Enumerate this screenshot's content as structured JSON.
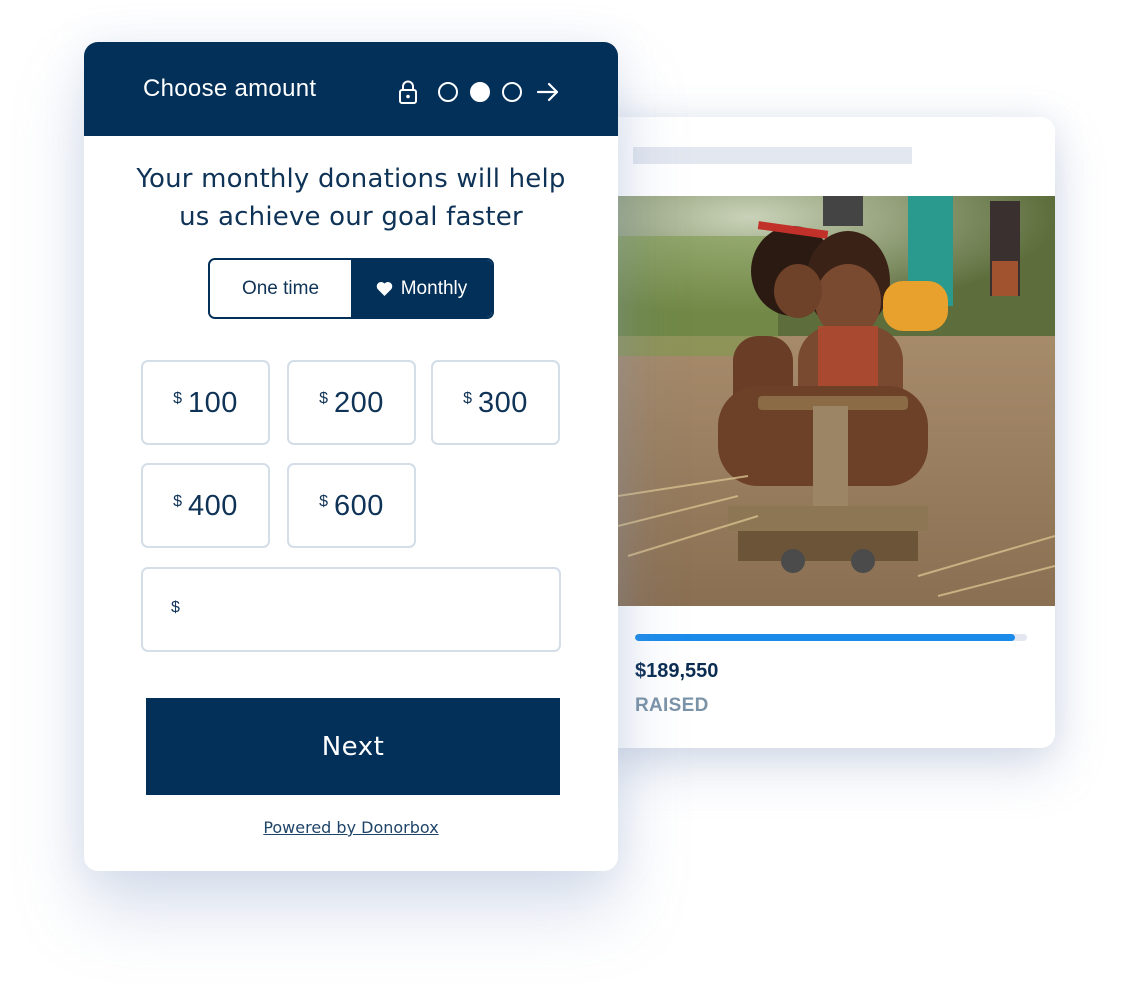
{
  "form": {
    "header": {
      "title": "Choose amount",
      "icons": [
        "lock-icon",
        "step-dot-icon",
        "step-dot-active-icon",
        "step-dot-icon",
        "arrow-right-icon"
      ],
      "steps_total": 3,
      "current_step": 2
    },
    "intro_line1": "Your monthly donations will help",
    "intro_line2": "us achieve our goal faster",
    "frequency": {
      "options": [
        {
          "label": "One time",
          "selected": false
        },
        {
          "label": "Monthly",
          "selected": true,
          "icon": "heart-icon"
        }
      ]
    },
    "currency_symbol": "$",
    "amounts": [
      {
        "value": "100"
      },
      {
        "value": "200"
      },
      {
        "value": "300"
      },
      {
        "value": "400"
      },
      {
        "value": "600"
      }
    ],
    "custom_amount": {
      "value": "",
      "placeholder": ""
    },
    "next_label": "Next",
    "powered_by": "Powered by Donorbox"
  },
  "campaign": {
    "image_alt": "Children riding a wooden toy cart on a dirt path",
    "progress_percent": 97,
    "raised_amount": "$189,550",
    "raised_label": "RAISED"
  },
  "colors": {
    "brand_navy": "#023059",
    "progress_blue": "#1b8bea",
    "tile_border": "#d4dee8",
    "muted_label": "#7b93a7"
  }
}
